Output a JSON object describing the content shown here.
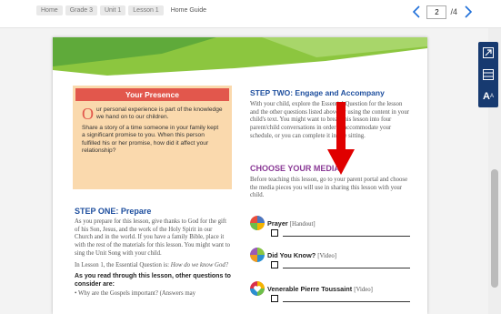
{
  "breadcrumb": {
    "items": [
      "Home",
      "Grade 3",
      "Unit 1",
      "Lesson 1",
      "Home Guide"
    ]
  },
  "pager": {
    "current_page": "2",
    "total_label": "/4",
    "prev_icon": "chevron-left-icon",
    "next_icon": "chevron-right-icon"
  },
  "toolbar": {
    "tools": [
      "expand-icon",
      "page-layout-icon",
      "text-size-icon"
    ],
    "text_size_label": "A",
    "text_size_sup": "A",
    "accent": "#173a70"
  },
  "document": {
    "presence": {
      "title": "Your Presence",
      "dropcap": "O",
      "text_first": "ur personal experience is part of the knowledge we hand on to our children.",
      "text_second": "Share a story of a time someone in your family kept a significant promise to you. When this person fulfilled his or her promise, how did it affect your relationship?",
      "title_color": "#e2574c",
      "box_color": "#fad9ad"
    },
    "step_one": {
      "heading": "STEP ONE: Prepare",
      "para1": "As you prepare for this lesson, give thanks to God for the gift of his Son, Jesus, and the work of the Holy Spirit in our Church and in the world. If you have a family Bible, place it with the rest of the materials for this lesson. You might want to sing the Unit Song with your child.",
      "para2_lead": "In Lesson 1, the Essential Question is: ",
      "para2_italic": "How do we know God?",
      "subheading": "As you read through this lesson, other questions to consider are:",
      "bullet": "• Why are the Gospels important? (Answers may"
    },
    "step_two": {
      "heading": "STEP TWO: Engage and Accompany",
      "text": "With your child, explore the Essential Question for the lesson and the other questions listed above by using the content in your child's text. You might want to break this lesson into four parent/child conversations in order to accommodate your schedule, or you can complete it in one sitting."
    },
    "media": {
      "heading": "CHOOSE YOUR MEDIA",
      "text": "Before teaching this lesson, go to your parent portal and choose the media pieces you will use in sharing this lesson with your child.",
      "items": [
        {
          "title": "Prayer",
          "type": "[Handout]",
          "icon": "prayer-icon"
        },
        {
          "title": "Did You Know?",
          "type": "[Video]",
          "icon": "did-you-know-icon"
        },
        {
          "title": "Venerable Pierre Toussaint",
          "type": "[Video]",
          "icon": "video-heart-icon"
        }
      ]
    },
    "heading_color": "#1d4e9e",
    "media_heading_color": "#8a3a96"
  },
  "annotation": {
    "arrow_icon": "red-down-arrow-icon",
    "color": "#e00000"
  }
}
